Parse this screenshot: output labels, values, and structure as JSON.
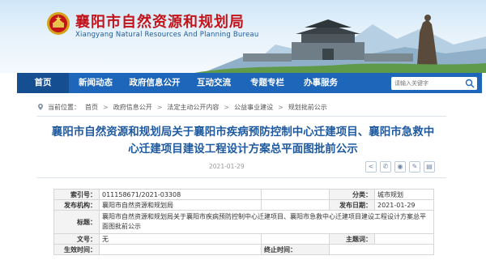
{
  "header": {
    "title": "襄阳市自然资源和规划局",
    "subtitle": "Xiangyang Natural Resources And Planning Bureau"
  },
  "nav": {
    "items": [
      "首页",
      "新闻动态",
      "政府信息公开",
      "互动交流",
      "专题专栏",
      "办事服务"
    ],
    "search_placeholder": "请输入关键字"
  },
  "breadcrumb": {
    "label": "当前位置：",
    "items": [
      "首页",
      "政府信息公开",
      "法定主动公开内容",
      "公益事业建设",
      "规划批前公示"
    ],
    "separator": ">"
  },
  "article": {
    "title": "襄阳市自然资源和规划局关于襄阳市疾病预防控制中心迁建项目、襄阳市急救中心迁建项目建设工程设计方案总平面图批前公示",
    "date": "2021-01-29"
  },
  "share_icons": [
    "wechat-icon",
    "weibo-icon",
    "qq-icon",
    "print-icon",
    "font-size-icon"
  ],
  "info": {
    "index_label": "索引号：",
    "index_value": "011158671/2021-03308",
    "category_label": "分类：",
    "category_value": "城市规划",
    "publisher_label": "发布机构：",
    "publisher_value": "襄阳市自然资源和规划局",
    "pubdate_label": "发布日期：",
    "pubdate_value": "2021-01-29",
    "title_label": "标题：",
    "title_value": "襄阳市自然资源和规划局关于襄阳市疾病预防控制中心迁建项目、襄阳市急救中心迁建项目建设工程设计方案总平面图批前公示",
    "docno_label": "文号：",
    "docno_value": "无",
    "keyword_label": "主题词：",
    "keyword_value": "",
    "effective_label": "生效时间：",
    "effective_value": "",
    "expire_label": "终止时间：",
    "expire_value": ""
  },
  "colors": {
    "title_red": "#c4141b",
    "nav_blue": "#1e66b9",
    "nav_active": "#154f92",
    "article_title_blue": "#1f5aa0"
  }
}
